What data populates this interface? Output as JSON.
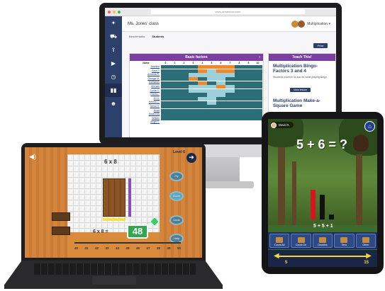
{
  "desktop": {
    "browser": {
      "url": "www.dreambox.com"
    },
    "sidebar": {
      "icons": [
        "logo-icon",
        "cart-icon",
        "export-icon",
        "play-icon",
        "clock-icon",
        "chart-icon",
        "people-icon"
      ]
    },
    "header": {
      "class_title": "Ms. Jones' class",
      "subject": "Multiplication ▾"
    },
    "tabs": [
      {
        "label": "Benchmarks"
      },
      {
        "label": "Students"
      }
    ],
    "print_label": "Print",
    "factors_panel": {
      "title": "Basic factors",
      "name_header": "Name",
      "columns": [
        "0",
        "1",
        "2",
        "3",
        "4",
        "5",
        "6",
        "7",
        "8",
        "9",
        "10"
      ],
      "rows": [
        {
          "name": "Jasmine",
          "cells": [
            "t",
            "t",
            "t",
            "t",
            "o",
            "o",
            "o",
            "o",
            "t",
            "t",
            "t"
          ]
        },
        {
          "name": "Sara P.",
          "cells": [
            "t",
            "t",
            "t",
            "t",
            "o",
            "l",
            "o",
            "o",
            "t",
            "t",
            "t"
          ]
        },
        {
          "name": "Amanda R.",
          "cells": [
            "t",
            "t",
            "t",
            "l",
            "l",
            "l",
            "l",
            "l",
            "t",
            "t",
            "t"
          ]
        },
        {
          "name": "Georgia M.",
          "cells": [
            "t",
            "t",
            "t",
            "o",
            "t",
            "l",
            "l",
            "t",
            "t",
            "t",
            "t"
          ]
        },
        {
          "name": "McKaelah",
          "cells": [
            "t",
            "t",
            "t",
            "t",
            "o",
            "t",
            "l",
            "t",
            "t",
            "t",
            "t"
          ]
        },
        {
          "name": "Michael",
          "cells": [
            "t",
            "t",
            "t",
            "l",
            "l",
            "l",
            "o",
            "l",
            "t",
            "t",
            "t"
          ]
        },
        {
          "name": "Cyrus G.",
          "cells": [
            "t",
            "t",
            "t",
            "l",
            "l",
            "l",
            "l",
            "l",
            "t",
            "t",
            "t"
          ]
        },
        {
          "name": "David L.",
          "cells": [
            "t",
            "t",
            "t",
            "t",
            "t",
            "l",
            "l",
            "t",
            "t",
            "t",
            "t"
          ]
        },
        {
          "name": "Eli D.",
          "cells": [
            "t",
            "t",
            "t",
            "t",
            "l",
            "l",
            "t",
            "t",
            "t",
            "t",
            "t"
          ]
        },
        {
          "name": "Helena C.",
          "cells": [
            "t",
            "t",
            "t",
            "t",
            "t",
            "l",
            "t",
            "t",
            "t",
            "t",
            "t"
          ]
        },
        {
          "name": "Jamal H.",
          "cells": [
            "t",
            "t",
            "t",
            "t",
            "t",
            "t",
            "t",
            "t",
            "t",
            "t",
            "t"
          ]
        },
        {
          "name": "Noah",
          "cells": [
            "t",
            "t",
            "t",
            "t",
            "t",
            "t",
            "t",
            "t",
            "t",
            "t",
            "t"
          ]
        },
        {
          "name": "Savannah",
          "cells": [
            "t",
            "t",
            "t",
            "t",
            "t",
            "t",
            "t",
            "t",
            "t",
            "t",
            "t"
          ]
        },
        {
          "name": "William",
          "cells": [
            "t",
            "t",
            "t",
            "t",
            "t",
            "t",
            "t",
            "t",
            "t",
            "t",
            "t"
          ]
        },
        {
          "name": "Angel X.",
          "cells": [
            "w",
            "w",
            "w",
            "w",
            "w",
            "w",
            "w",
            "w",
            "w",
            "w",
            "w"
          ]
        }
      ]
    },
    "teach_panel": {
      "title": "Teach This!",
      "lesson_1": "Multiplication Bingo- Factors 3 and 4",
      "lesson_1_desc": "Students practice 3s and 4s while playing Bingo.",
      "view_label": "View lesson",
      "lesson_2": "Multiplication Make-a-Square Game"
    }
  },
  "laptop": {
    "level": "Level 6",
    "top_expression": "6 x 8",
    "equation": "6 x 8 =",
    "answer": "48",
    "side_buttons": [
      "Fly",
      "Zoom",
      "Undo",
      "Help"
    ],
    "numberline": [
      "40",
      "41",
      "42",
      "43",
      "44",
      "45",
      "46",
      "47",
      "48",
      "49",
      "50"
    ]
  },
  "tablet": {
    "player": "David K.",
    "equation": "5 + 6 = ?",
    "sum": "5 + 5 + 1",
    "bars": [
      {
        "value": 6,
        "color": "#d4171f"
      },
      {
        "value": 5,
        "color": "#111111"
      },
      {
        "value": 1,
        "color": "#111111"
      }
    ],
    "strategies": [
      "Count All",
      "Count On",
      "Doubles",
      "Tens",
      "Other"
    ],
    "range_low": "5",
    "range_high": "15"
  },
  "colors": {
    "brand_navy": "#2d3f6b",
    "panel_purple": "#7b3fa0",
    "cell_teal": "#2b6e78",
    "cell_light": "#9cd1dc",
    "cell_orange": "#f08a2c",
    "answer_green": "#2fa84f"
  }
}
